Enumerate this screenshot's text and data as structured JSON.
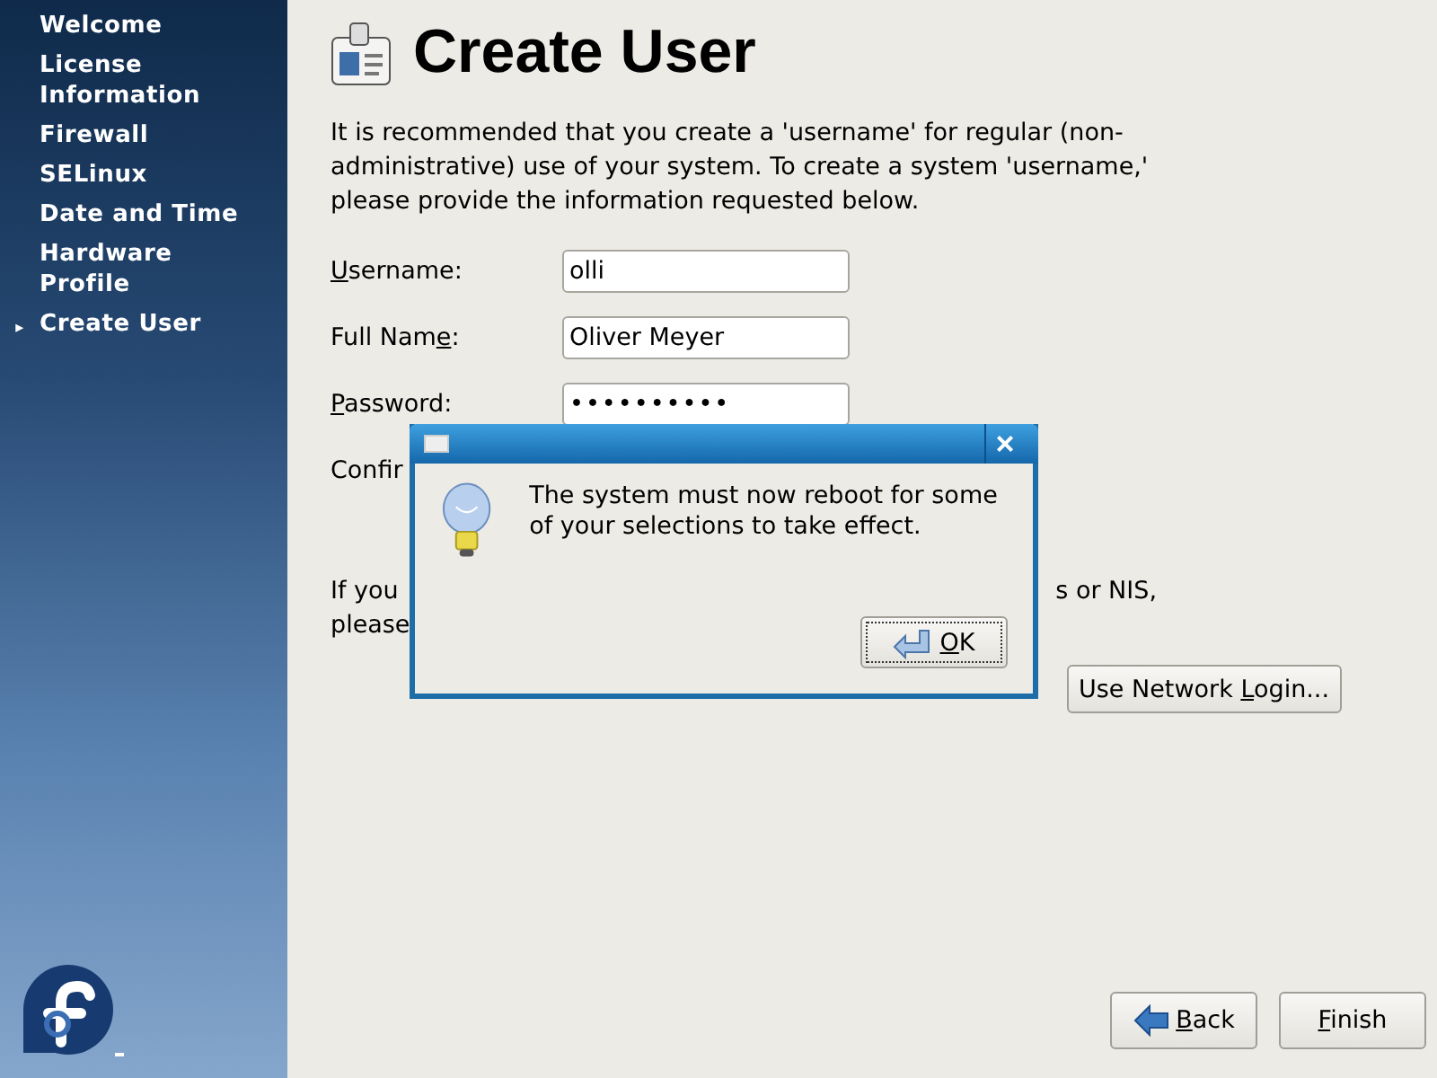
{
  "sidebar": {
    "marker": "▸",
    "items": [
      {
        "label": "Welcome",
        "selected": false
      },
      {
        "label": "License Information",
        "selected": false
      },
      {
        "label": "Firewall",
        "selected": false
      },
      {
        "label": "SELinux",
        "selected": false
      },
      {
        "label": "Date and Time",
        "selected": false
      },
      {
        "label": "Hardware Profile",
        "selected": false
      },
      {
        "label": "Create User",
        "selected": true
      }
    ]
  },
  "page": {
    "title": "Create User",
    "intro": "It is recommended that you create a 'username' for regular (non-administrative) use of your system. To create a system 'username,' please provide the information requested below.",
    "fields": [
      {
        "label": {
          "key": "U",
          "after": "sername:"
        },
        "value": "olli",
        "kind": "text"
      },
      {
        "label": {
          "before": "Full Nam",
          "key": "e",
          "after": ":"
        },
        "value": "Oliver Meyer",
        "kind": "text"
      },
      {
        "label": {
          "key": "P",
          "after": "assword:"
        },
        "value": "••••••••••",
        "kind": "password"
      }
    ],
    "confirm_label": "Confir",
    "network_text": {
      "line1_start": "If you",
      "line1_end": "s or NIS,",
      "line2_start": "please"
    },
    "network_button": {
      "label": {
        "before": "Use Network ",
        "key": "L",
        "after": "ogin..."
      }
    }
  },
  "dialog": {
    "close": "×",
    "message": "The system must now reboot for some of your selections to take effect.",
    "button": {
      "label": {
        "key": "O",
        "after": "K"
      }
    }
  },
  "footer": {
    "buttons": [
      {
        "label": {
          "key": "B",
          "after": "ack"
        },
        "kind": "back"
      },
      {
        "label": {
          "key": "F",
          "after": "inish"
        },
        "kind": "plain"
      }
    ]
  }
}
